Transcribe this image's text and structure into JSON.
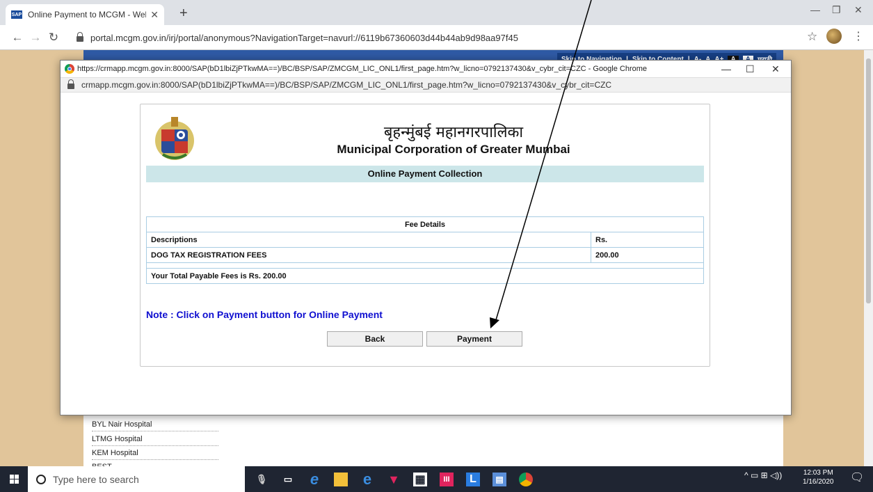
{
  "browser": {
    "tab_title": "Online Payment to MCGM - Welc",
    "tab_favicon": "SAP",
    "new_tab": "+",
    "url": "portal.mcgm.gov.in/irj/portal/anonymous?NavigationTarget=navurl://6119b67360603d44b44ab9d98aa97f45"
  },
  "background_page": {
    "skip_nav": "Skip to Navigation",
    "skip_content": "Skip to Content",
    "font_small": "A-",
    "font_normal": "A",
    "font_large": "A+",
    "contrast_a": "A",
    "contrast_b": "A",
    "language": "मराठी",
    "hospitals": [
      "BYL Nair Hospital",
      "LTMG Hospital",
      "KEM Hospital",
      "BEST"
    ]
  },
  "popup": {
    "title": "https://crmapp.mcgm.gov.in:8000/SAP(bD1lbiZjPTkwMA==)/BC/BSP/SAP/ZMCGM_LIC_ONL1/first_page.htm?w_licno=0792137430&v_cybr_cit=CZC - Google Chrome",
    "url": "crmapp.mcgm.gov.in:8000/SAP(bD1lbiZjPTkwMA==)/BC/BSP/SAP/ZMCGM_LIC_ONL1/first_page.htm?w_licno=0792137430&v_cybr_cit=CZC"
  },
  "page": {
    "heading_hindi": "बृहन्मुंबई महानगरपालिका",
    "heading_english": "Municipal Corporation of Greater Mumbai",
    "section_title": "Online Payment Collection",
    "fee_table": {
      "caption": "Fee Details",
      "headers": [
        "Descriptions",
        "Rs."
      ],
      "rows": [
        [
          "DOG TAX REGISTRATION FEES",
          "200.00"
        ]
      ],
      "total_text": "Your Total Payable Fees is Rs. 200.00"
    },
    "note": "Note : Click on Payment button for Online Payment",
    "back_label": "Back",
    "payment_label": "Payment"
  },
  "taskbar": {
    "search_placeholder": "Type here to search",
    "time": "12:03 PM",
    "date": "1/16/2020"
  },
  "colors": {
    "section_band": "#cce6e9",
    "note_text": "#0f0fd0",
    "table_border": "#a9cde3",
    "background_beige": "#e1c59a",
    "background_blue": "#2f5aa5"
  }
}
